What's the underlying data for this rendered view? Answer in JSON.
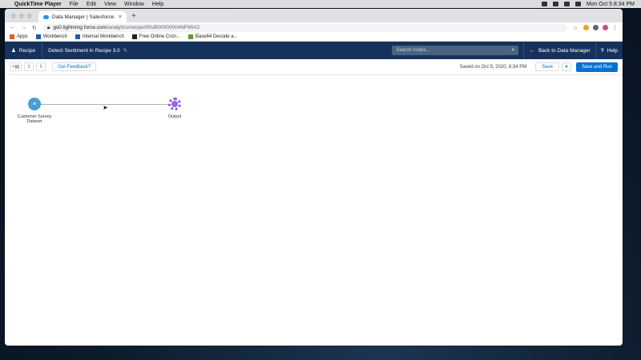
{
  "menubar": {
    "app_name": "QuickTime Player",
    "items": [
      "File",
      "Edit",
      "View",
      "Window",
      "Help"
    ],
    "clock": "Mon Oct 5  8:34 PM"
  },
  "browser": {
    "tab_title": "Data Manager | Salesforce",
    "url_host": "gs0.lightning.force.com",
    "url_path": "/analytics/recipe/05vB00000004NFMIA2",
    "bookmarks": [
      "Apps",
      "Workbench",
      "Internal Workbench",
      "Free Online Cron...",
      "Base64 Decode a..."
    ]
  },
  "header": {
    "app_label": "Recipe",
    "recipe_title": "Detect Sentiment in Recipe 3.0",
    "search_placeholder": "Search nodes...",
    "back_label": "Back to Data Manager",
    "help_label": "Help"
  },
  "toolbar": {
    "feedback_label": "Got Feedback?",
    "saved_text": "Saved on Oct 5, 2020, 8:34 PM",
    "save_label": "Save",
    "save_run_label": "Save and Run"
  },
  "nodes": [
    {
      "label": "Customer Survey Dataset",
      "type": "dataset-icon"
    },
    {
      "label": "Output",
      "type": "output-icon"
    }
  ],
  "colors": {
    "header_bg": "#16325c",
    "brand_blue": "#0070d2",
    "dataset_node": "#4a9ed1",
    "output_node": "#9f63e0"
  }
}
